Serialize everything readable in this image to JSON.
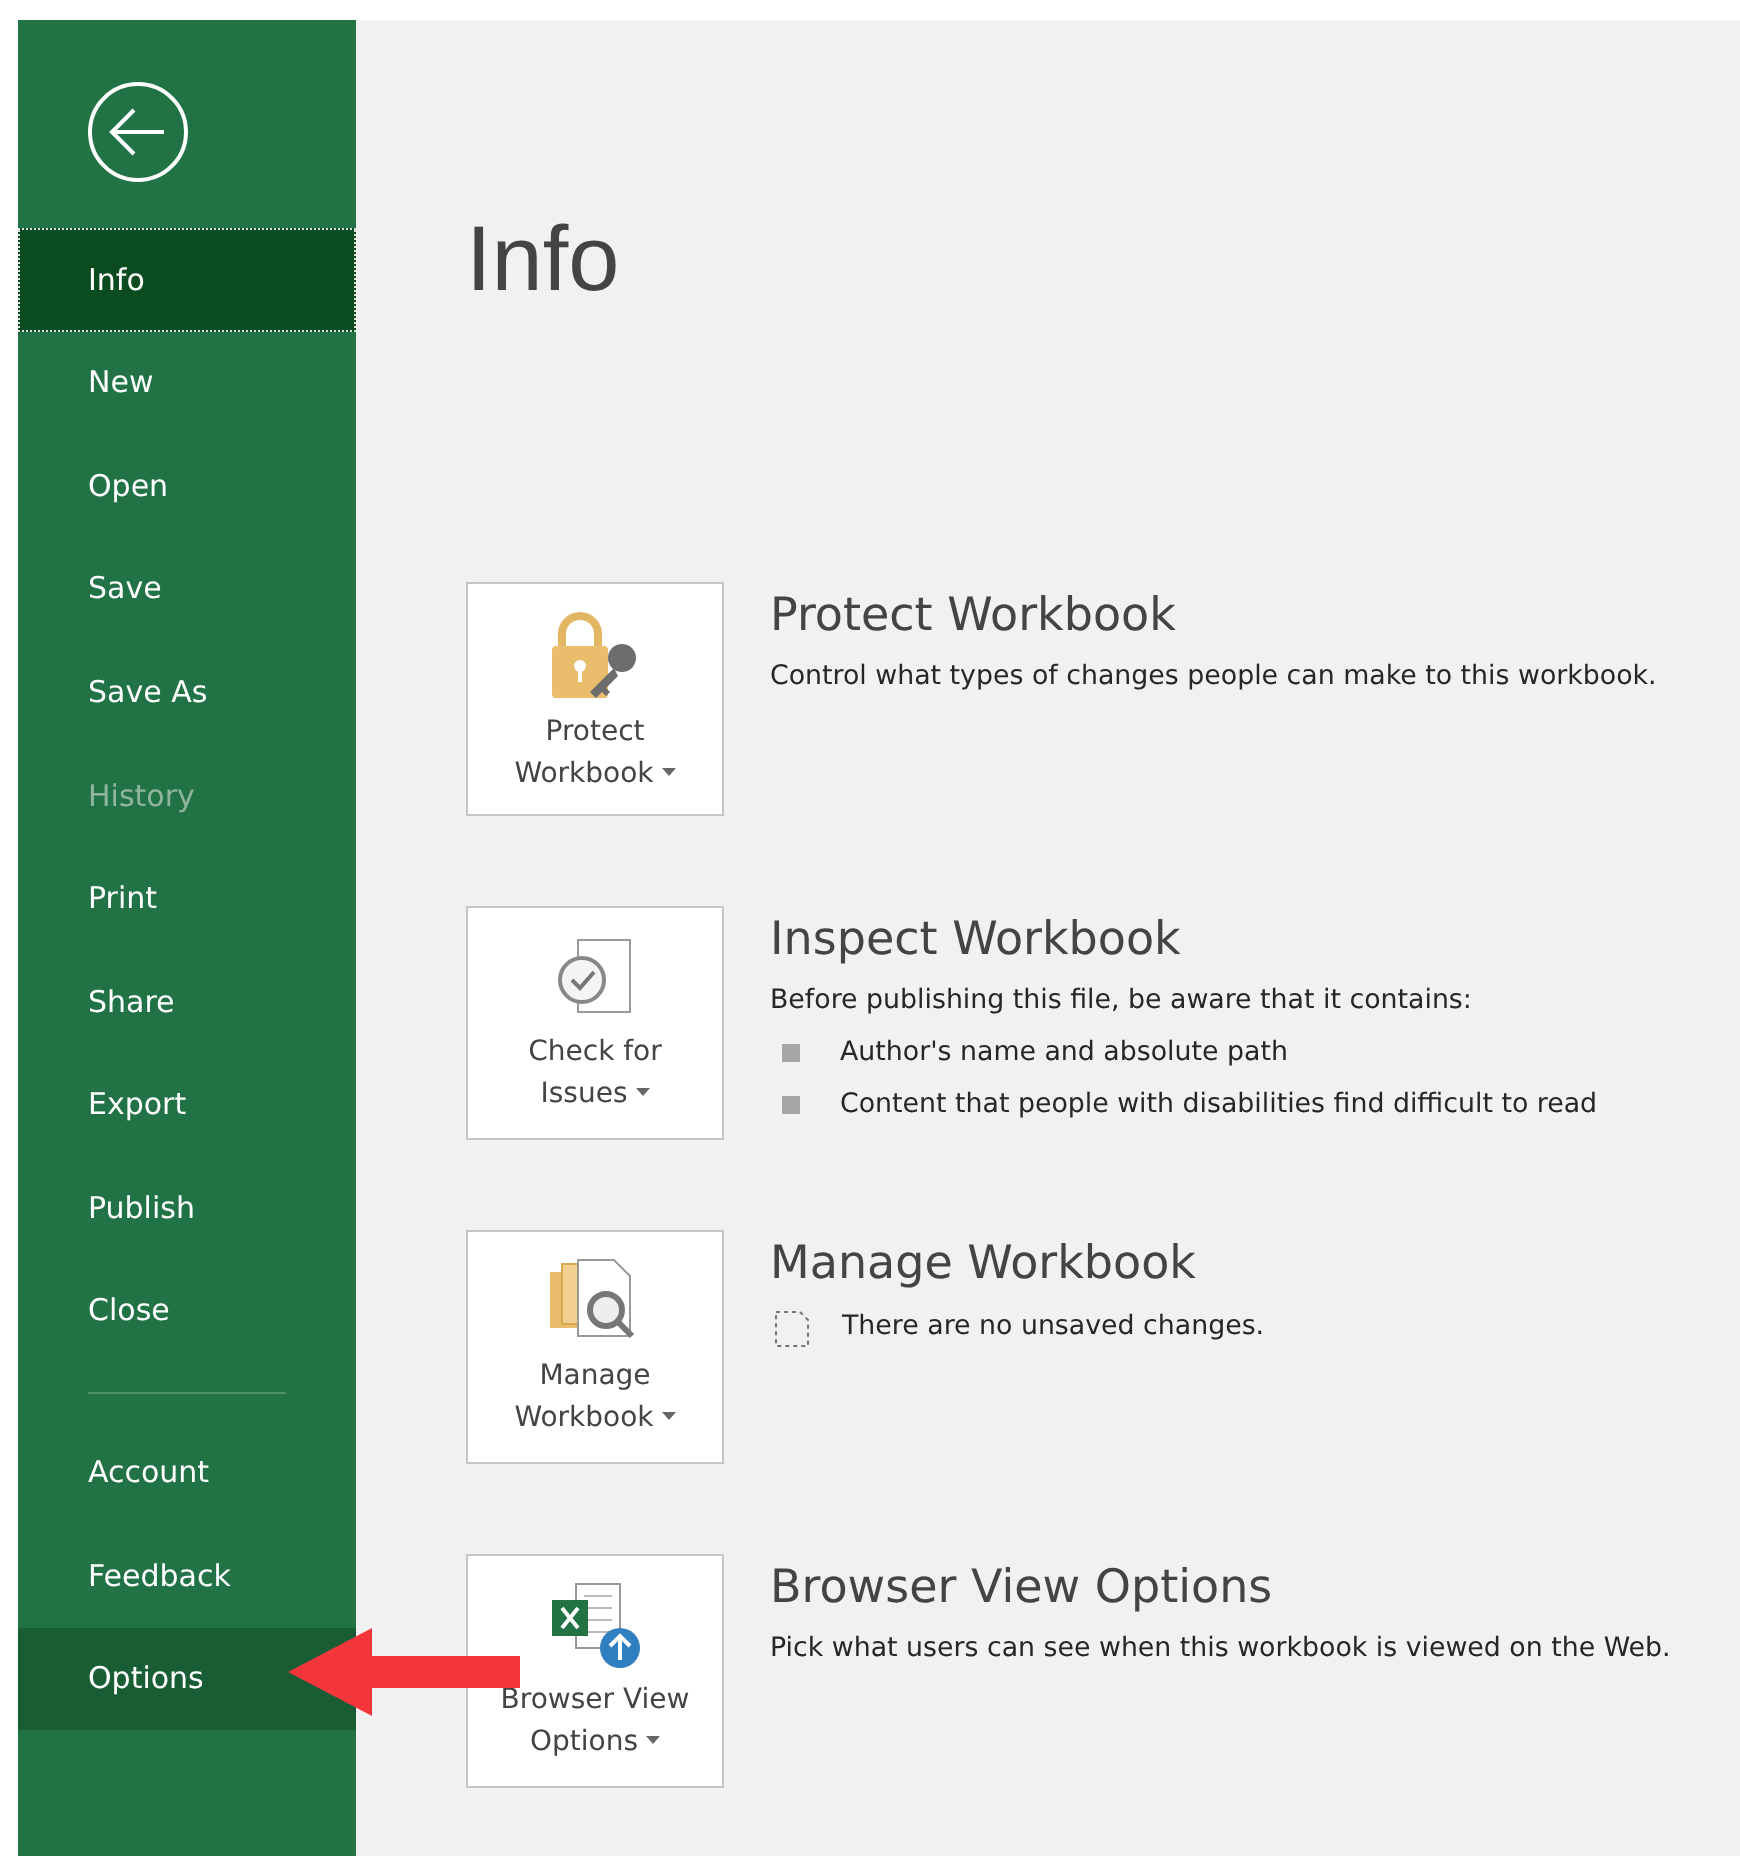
{
  "sidebar": {
    "back_button": {
      "kind": "back"
    },
    "items": [
      {
        "label": "Info",
        "selected": true,
        "hovered": false,
        "disabled": false
      },
      {
        "label": "New",
        "selected": false,
        "hovered": false,
        "disabled": false
      },
      {
        "label": "Open",
        "selected": false,
        "hovered": false,
        "disabled": false
      },
      {
        "label": "Save",
        "selected": false,
        "hovered": false,
        "disabled": false
      },
      {
        "label": "Save As",
        "selected": false,
        "hovered": false,
        "disabled": false
      },
      {
        "label": "History",
        "selected": false,
        "hovered": false,
        "disabled": true
      },
      {
        "label": "Print",
        "selected": false,
        "hovered": false,
        "disabled": false
      },
      {
        "label": "Share",
        "selected": false,
        "hovered": false,
        "disabled": false
      },
      {
        "label": "Export",
        "selected": false,
        "hovered": false,
        "disabled": false
      },
      {
        "label": "Publish",
        "selected": false,
        "hovered": false,
        "disabled": false
      },
      {
        "label": "Close",
        "selected": false,
        "hovered": false,
        "disabled": false,
        "separator_after": true
      },
      {
        "label": "Account",
        "selected": false,
        "hovered": false,
        "disabled": false
      },
      {
        "label": "Feedback",
        "selected": false,
        "hovered": false,
        "disabled": false
      },
      {
        "label": "Options",
        "selected": false,
        "hovered": true,
        "disabled": false
      }
    ]
  },
  "page_title": "Info",
  "sections": [
    {
      "kind": "protect",
      "button": [
        "Protect",
        "Workbook"
      ],
      "title": "Protect Workbook",
      "description": "Control what types of changes people can make to this workbook."
    },
    {
      "kind": "inspect",
      "button": [
        "Check for",
        "Issues"
      ],
      "title": "Inspect Workbook",
      "description": "Before publishing this file, be aware that it contains:",
      "bullets": [
        "Author's name and absolute path",
        "Content that people with disabilities find difficult to read"
      ]
    },
    {
      "kind": "manage",
      "button": [
        "Manage",
        "Workbook"
      ],
      "title": "Manage Workbook",
      "note": "There are no unsaved changes."
    },
    {
      "kind": "browser",
      "button": [
        "Browser View",
        "Options"
      ],
      "title": "Browser View Options",
      "description": "Pick what users can see when this workbook is viewed on the Web."
    }
  ]
}
